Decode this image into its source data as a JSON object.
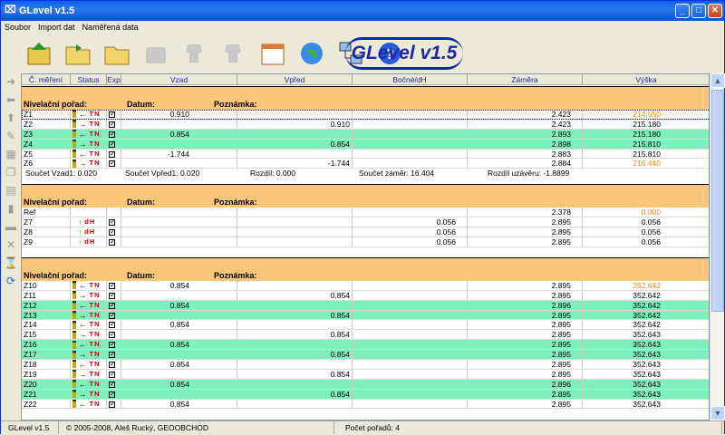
{
  "window": {
    "title": "GLevel v1.5",
    "icon": "ruler-icon",
    "accent": "#0a5ee8"
  },
  "menu": [
    "Soubor",
    "Import dat",
    "Naměřená data"
  ],
  "toolbar": [
    "import-icon",
    "open-folder-icon",
    "folder-icon",
    "gray-device-icon",
    "gray-head-icon",
    "gray-head2-icon",
    "calendar-icon",
    "globe-icon",
    "network-icon",
    "help-icon"
  ],
  "logo": "GLevel v1.5",
  "columns": [
    "Č. měření",
    "Status",
    "Exp",
    "Vzad",
    "Vpřed",
    "Bočné/dH",
    "Záměra",
    "Výška"
  ],
  "section_labels": {
    "nivel": "Nivelační pořad:",
    "datum": "Datum:",
    "poznamka": "Poznámka:"
  },
  "sections": [
    {
      "rows": [
        {
          "id": "Z1",
          "arrow": "←",
          "code": "TN",
          "vzad": "0.910",
          "vpred": "",
          "bocne": "",
          "zamera": "2.423",
          "vyska": "214.550",
          "orange": true,
          "green": false,
          "sel": true
        },
        {
          "id": "Z2",
          "arrow": "→",
          "code": "TN",
          "vzad": "",
          "vpred": "0.910",
          "bocne": "",
          "zamera": "2.423",
          "vyska": "215.180",
          "green": false
        },
        {
          "id": "Z3",
          "arrow": "←",
          "code": "TN",
          "vzad": "0.854",
          "vpred": "",
          "bocne": "",
          "zamera": "2.893",
          "vyska": "215.180",
          "green": true
        },
        {
          "id": "Z4",
          "arrow": "→",
          "code": "TN",
          "vzad": "",
          "vpred": "0.854",
          "bocne": "",
          "zamera": "2.898",
          "vyska": "215.810",
          "green": true
        },
        {
          "id": "Z5",
          "arrow": "←",
          "code": "TN",
          "vzad": "-1.744",
          "vpred": "",
          "bocne": "",
          "zamera": "2.883",
          "vyska": "215.810",
          "green": false
        },
        {
          "id": "Z6",
          "arrow": "→",
          "code": "TN",
          "vzad": "",
          "vpred": "-1.744",
          "bocne": "",
          "zamera": "2.884",
          "vyska": "216.440",
          "orange": true,
          "green": false
        }
      ],
      "summary": [
        "Součet Vzad1: 0.020",
        "Součet Vpřed1: 0.020",
        "Rozdíl: 0.000",
        "Součet záměr: 16.404",
        "Rozdíl uzávěru: -1.8899"
      ]
    },
    {
      "rows": [
        {
          "id": "Ref",
          "arrow": "",
          "code": "",
          "vzad": "",
          "vpred": "",
          "bocne": "",
          "zamera": "2.378",
          "vyska": "0.000",
          "orange": true,
          "green": false
        },
        {
          "id": "Z7",
          "arrow": "↑",
          "code": "dH",
          "vzad": "",
          "vpred": "",
          "bocne": "0.056",
          "zamera": "2.895",
          "vyska": "0.056",
          "green": false
        },
        {
          "id": "Z8",
          "arrow": "↑",
          "code": "dH",
          "vzad": "",
          "vpred": "",
          "bocne": "0.056",
          "zamera": "2.895",
          "vyska": "0.056",
          "green": false
        },
        {
          "id": "Z9",
          "arrow": "↑",
          "code": "dH",
          "vzad": "",
          "vpred": "",
          "bocne": "0.056",
          "zamera": "2.895",
          "vyska": "0.056",
          "green": false
        }
      ]
    },
    {
      "rows": [
        {
          "id": "Z10",
          "arrow": "←",
          "code": "TN",
          "vzad": "0.854",
          "vpred": "",
          "bocne": "",
          "zamera": "2.895",
          "vyska": "352.642",
          "orange": true,
          "green": false
        },
        {
          "id": "Z11",
          "arrow": "→",
          "code": "TN",
          "vzad": "",
          "vpred": "0.854",
          "bocne": "",
          "zamera": "2.895",
          "vyska": "352.642",
          "green": false
        },
        {
          "id": "Z12",
          "arrow": "←",
          "code": "TN",
          "vzad": "0.854",
          "vpred": "",
          "bocne": "",
          "zamera": "2.896",
          "vyska": "352.642",
          "green": true
        },
        {
          "id": "Z13",
          "arrow": "→",
          "code": "TN",
          "vzad": "",
          "vpred": "0.854",
          "bocne": "",
          "zamera": "2.895",
          "vyska": "352.642",
          "green": true
        },
        {
          "id": "Z14",
          "arrow": "←",
          "code": "TN",
          "vzad": "0.854",
          "vpred": "",
          "bocne": "",
          "zamera": "2.895",
          "vyska": "352.642",
          "green": false
        },
        {
          "id": "Z15",
          "arrow": "→",
          "code": "TN",
          "vzad": "",
          "vpred": "0.854",
          "bocne": "",
          "zamera": "2.895",
          "vyska": "352.643",
          "green": false
        },
        {
          "id": "Z16",
          "arrow": "←",
          "code": "TN",
          "vzad": "0.854",
          "vpred": "",
          "bocne": "",
          "zamera": "2.895",
          "vyska": "352.643",
          "green": true
        },
        {
          "id": "Z17",
          "arrow": "→",
          "code": "TN",
          "vzad": "",
          "vpred": "0.854",
          "bocne": "",
          "zamera": "2.895",
          "vyska": "352.643",
          "green": true
        },
        {
          "id": "Z18",
          "arrow": "←",
          "code": "TN",
          "vzad": "0.854",
          "vpred": "",
          "bocne": "",
          "zamera": "2.895",
          "vyska": "352.643",
          "green": false
        },
        {
          "id": "Z19",
          "arrow": "→",
          "code": "TN",
          "vzad": "",
          "vpred": "0.854",
          "bocne": "",
          "zamera": "2.895",
          "vyska": "352.643",
          "green": false
        },
        {
          "id": "Z20",
          "arrow": "←",
          "code": "TN",
          "vzad": "0.854",
          "vpred": "",
          "bocne": "",
          "zamera": "2.896",
          "vyska": "352.643",
          "green": true
        },
        {
          "id": "Z21",
          "arrow": "→",
          "code": "TN",
          "vzad": "",
          "vpred": "0.854",
          "bocne": "",
          "zamera": "2.895",
          "vyska": "352.643",
          "green": true
        },
        {
          "id": "Z22",
          "arrow": "←",
          "code": "TN",
          "vzad": "0.854",
          "vpred": "",
          "bocne": "",
          "zamera": "2.895",
          "vyska": "352.643",
          "green": false
        }
      ]
    }
  ],
  "status": {
    "app": "GLevel v1.5",
    "copyright": "© 2005-2008, Aleš Rucký, GEOOBCHOD",
    "count": "Počet pořadů: 4"
  }
}
